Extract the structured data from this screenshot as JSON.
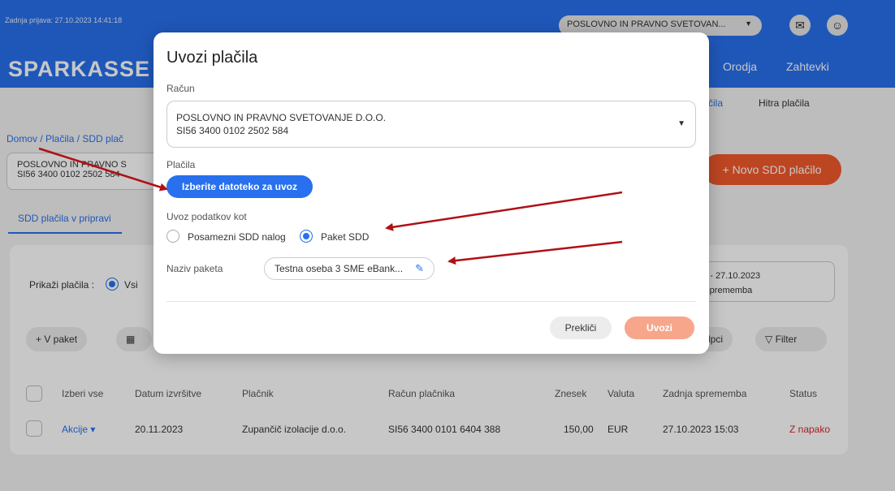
{
  "header": {
    "last_login": "Zadnja prijava: 27.10.2023 14:41:18",
    "logo": "SPARKASSE",
    "account_selector": "POSLOVNO IN PRAVNO SVETOVAN...",
    "nav": [
      "Orodja",
      "Zahtevki"
    ],
    "subnav": [
      "čila",
      "Hitra plačila"
    ]
  },
  "breadcrumb": "Domov / Plačila / SDD plač",
  "account_box": {
    "name": "POSLOVNO IN PRAVNO S",
    "iban": "SI56 3400 0102 2502 584"
  },
  "new_sdd_button": "+ Novo SDD plačilo",
  "tab_active": "SDD plačila v pripravi",
  "filters": {
    "show_label": "Prikaži plačila :",
    "show_all": "Vsi",
    "date_range": "23 - 27.10.2023",
    "date_sub": "a sprememba"
  },
  "toolbar": {
    "package": "+ V paket",
    "columns": "tolpci",
    "filter": "Filter"
  },
  "table": {
    "headers": [
      "Izberi vse",
      "Datum izvršitve",
      "Plačnik",
      "Račun plačnika",
      "Znesek",
      "Valuta",
      "Zadnja sprememba",
      "Status"
    ],
    "row": {
      "actions": "Akcije",
      "date": "20.11.2023",
      "payer": "Zupančič izolacije d.o.o.",
      "account": "SI56 3400 0101 6404 388",
      "amount": "150,00",
      "currency": "EUR",
      "changed": "27.10.2023 15:03",
      "status": "Z napako"
    }
  },
  "modal": {
    "title": "Uvozi plačila",
    "account_label": "Račun",
    "account_name": "POSLOVNO IN PRAVNO SVETOVANJE D.O.O.",
    "account_iban": "SI56 3400 0102 2502 584",
    "payments_label": "Plačila",
    "choose_file": "Izberite datoteko za uvoz",
    "import_as_label": "Uvoz podatkov kot",
    "option_single": "Posamezni SDD nalog",
    "option_package": "Paket SDD",
    "package_name_label": "Naziv paketa",
    "package_name_value": "Testna oseba 3 SME eBank...",
    "cancel": "Prekliči",
    "import": "Uvozi"
  },
  "colors": {
    "primary": "#2870ed",
    "accent": "#f25a2c",
    "error": "#d9262c",
    "arrow": "#b01015"
  }
}
